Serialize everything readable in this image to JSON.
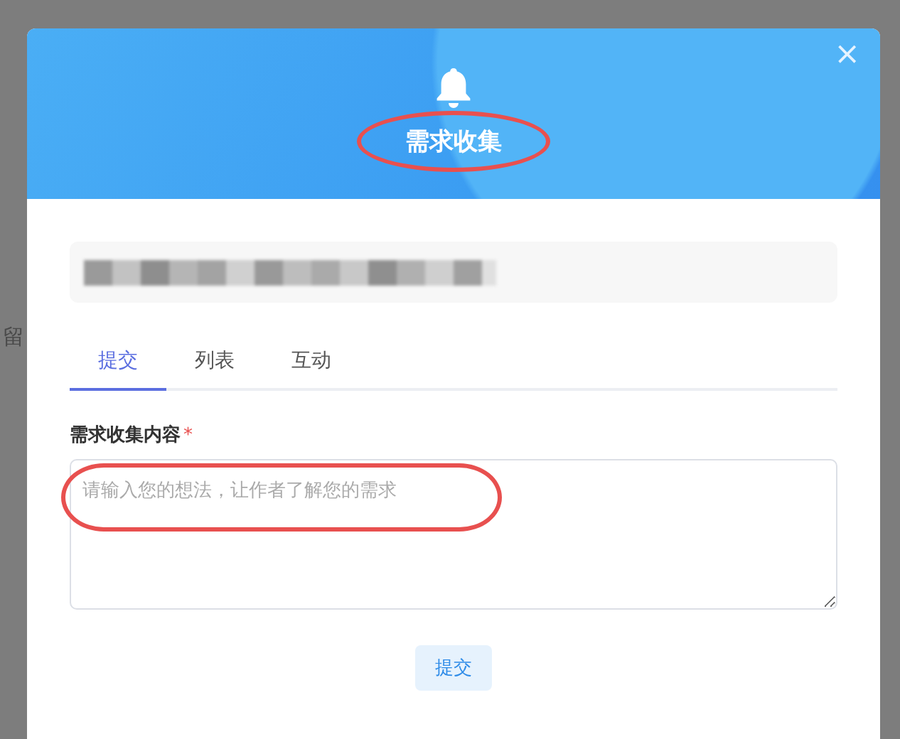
{
  "background": {
    "texts": [
      "留"
    ]
  },
  "dialog": {
    "title": "需求收集",
    "title_circled": true,
    "close": "×",
    "notice": {
      "kind": "redacted"
    },
    "tabs": [
      {
        "label": "提交",
        "selected": true
      },
      {
        "label": "列表",
        "selected": false
      },
      {
        "label": "互动",
        "selected": false
      }
    ],
    "field": {
      "label": "需求收集内容",
      "required": true,
      "required_mark": "*",
      "placeholder": "请输入您的想法，让作者了解您的需求",
      "placeholder_circled": true
    },
    "submit": "提交"
  }
}
